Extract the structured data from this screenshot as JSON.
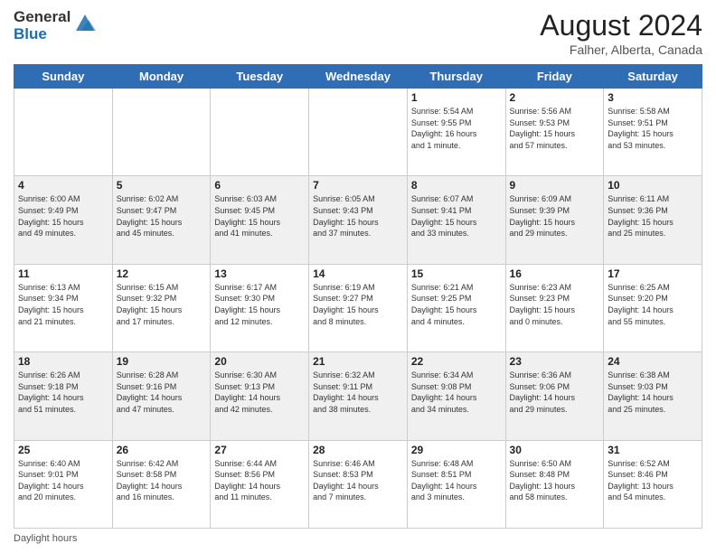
{
  "header": {
    "logo_general": "General",
    "logo_blue": "Blue",
    "month_year": "August 2024",
    "location": "Falher, Alberta, Canada"
  },
  "days_of_week": [
    "Sunday",
    "Monday",
    "Tuesday",
    "Wednesday",
    "Thursday",
    "Friday",
    "Saturday"
  ],
  "footer": {
    "daylight_hours": "Daylight hours"
  },
  "weeks": [
    [
      {
        "day": "",
        "info": ""
      },
      {
        "day": "",
        "info": ""
      },
      {
        "day": "",
        "info": ""
      },
      {
        "day": "",
        "info": ""
      },
      {
        "day": "1",
        "info": "Sunrise: 5:54 AM\nSunset: 9:55 PM\nDaylight: 16 hours\nand 1 minute."
      },
      {
        "day": "2",
        "info": "Sunrise: 5:56 AM\nSunset: 9:53 PM\nDaylight: 15 hours\nand 57 minutes."
      },
      {
        "day": "3",
        "info": "Sunrise: 5:58 AM\nSunset: 9:51 PM\nDaylight: 15 hours\nand 53 minutes."
      }
    ],
    [
      {
        "day": "4",
        "info": "Sunrise: 6:00 AM\nSunset: 9:49 PM\nDaylight: 15 hours\nand 49 minutes."
      },
      {
        "day": "5",
        "info": "Sunrise: 6:02 AM\nSunset: 9:47 PM\nDaylight: 15 hours\nand 45 minutes."
      },
      {
        "day": "6",
        "info": "Sunrise: 6:03 AM\nSunset: 9:45 PM\nDaylight: 15 hours\nand 41 minutes."
      },
      {
        "day": "7",
        "info": "Sunrise: 6:05 AM\nSunset: 9:43 PM\nDaylight: 15 hours\nand 37 minutes."
      },
      {
        "day": "8",
        "info": "Sunrise: 6:07 AM\nSunset: 9:41 PM\nDaylight: 15 hours\nand 33 minutes."
      },
      {
        "day": "9",
        "info": "Sunrise: 6:09 AM\nSunset: 9:39 PM\nDaylight: 15 hours\nand 29 minutes."
      },
      {
        "day": "10",
        "info": "Sunrise: 6:11 AM\nSunset: 9:36 PM\nDaylight: 15 hours\nand 25 minutes."
      }
    ],
    [
      {
        "day": "11",
        "info": "Sunrise: 6:13 AM\nSunset: 9:34 PM\nDaylight: 15 hours\nand 21 minutes."
      },
      {
        "day": "12",
        "info": "Sunrise: 6:15 AM\nSunset: 9:32 PM\nDaylight: 15 hours\nand 17 minutes."
      },
      {
        "day": "13",
        "info": "Sunrise: 6:17 AM\nSunset: 9:30 PM\nDaylight: 15 hours\nand 12 minutes."
      },
      {
        "day": "14",
        "info": "Sunrise: 6:19 AM\nSunset: 9:27 PM\nDaylight: 15 hours\nand 8 minutes."
      },
      {
        "day": "15",
        "info": "Sunrise: 6:21 AM\nSunset: 9:25 PM\nDaylight: 15 hours\nand 4 minutes."
      },
      {
        "day": "16",
        "info": "Sunrise: 6:23 AM\nSunset: 9:23 PM\nDaylight: 15 hours\nand 0 minutes."
      },
      {
        "day": "17",
        "info": "Sunrise: 6:25 AM\nSunset: 9:20 PM\nDaylight: 14 hours\nand 55 minutes."
      }
    ],
    [
      {
        "day": "18",
        "info": "Sunrise: 6:26 AM\nSunset: 9:18 PM\nDaylight: 14 hours\nand 51 minutes."
      },
      {
        "day": "19",
        "info": "Sunrise: 6:28 AM\nSunset: 9:16 PM\nDaylight: 14 hours\nand 47 minutes."
      },
      {
        "day": "20",
        "info": "Sunrise: 6:30 AM\nSunset: 9:13 PM\nDaylight: 14 hours\nand 42 minutes."
      },
      {
        "day": "21",
        "info": "Sunrise: 6:32 AM\nSunset: 9:11 PM\nDaylight: 14 hours\nand 38 minutes."
      },
      {
        "day": "22",
        "info": "Sunrise: 6:34 AM\nSunset: 9:08 PM\nDaylight: 14 hours\nand 34 minutes."
      },
      {
        "day": "23",
        "info": "Sunrise: 6:36 AM\nSunset: 9:06 PM\nDaylight: 14 hours\nand 29 minutes."
      },
      {
        "day": "24",
        "info": "Sunrise: 6:38 AM\nSunset: 9:03 PM\nDaylight: 14 hours\nand 25 minutes."
      }
    ],
    [
      {
        "day": "25",
        "info": "Sunrise: 6:40 AM\nSunset: 9:01 PM\nDaylight: 14 hours\nand 20 minutes."
      },
      {
        "day": "26",
        "info": "Sunrise: 6:42 AM\nSunset: 8:58 PM\nDaylight: 14 hours\nand 16 minutes."
      },
      {
        "day": "27",
        "info": "Sunrise: 6:44 AM\nSunset: 8:56 PM\nDaylight: 14 hours\nand 11 minutes."
      },
      {
        "day": "28",
        "info": "Sunrise: 6:46 AM\nSunset: 8:53 PM\nDaylight: 14 hours\nand 7 minutes."
      },
      {
        "day": "29",
        "info": "Sunrise: 6:48 AM\nSunset: 8:51 PM\nDaylight: 14 hours\nand 3 minutes."
      },
      {
        "day": "30",
        "info": "Sunrise: 6:50 AM\nSunset: 8:48 PM\nDaylight: 13 hours\nand 58 minutes."
      },
      {
        "day": "31",
        "info": "Sunrise: 6:52 AM\nSunset: 8:46 PM\nDaylight: 13 hours\nand 54 minutes."
      }
    ]
  ]
}
